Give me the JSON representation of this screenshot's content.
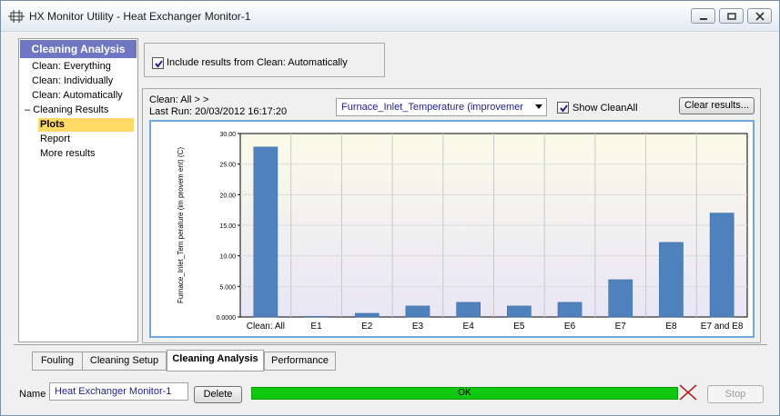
{
  "window": {
    "title": "HX Monitor Utility - Heat Exchanger Monitor-1"
  },
  "sidebar": {
    "header": "Cleaning Analysis",
    "items": [
      {
        "label": "Clean: Everything"
      },
      {
        "label": "Clean: Individually"
      },
      {
        "label": "Clean: Automatically"
      },
      {
        "label": "Cleaning Results"
      },
      {
        "label": "Plots",
        "selected": true
      },
      {
        "label": "Report"
      },
      {
        "label": "More results"
      }
    ]
  },
  "options": {
    "include_label": "Include results from Clean: Automatically",
    "include_checked": true
  },
  "results": {
    "clean_line": "Clean: All > >",
    "last_run": "Last Run: 20/03/2012 16:17:20",
    "variable": "Furnace_Inlet_Temperature (improvemer",
    "show_cleanall_label": "Show CleanAll",
    "show_cleanall_checked": true,
    "clear_label": "Clear results..."
  },
  "chart_data": {
    "type": "bar",
    "ylabel": "Furnace_Inlet_Tem perature (im provem ent) (C)",
    "ylim": [
      0,
      30
    ],
    "yticks": [
      "0.0000",
      "5.000",
      "10.00",
      "15.00",
      "20.00",
      "25.00",
      "30.00"
    ],
    "grid": true,
    "bar_color": "#4f81bd",
    "categories": [
      "Clean: All",
      "E1",
      "E2",
      "E3",
      "E4",
      "E5",
      "E6",
      "E7",
      "E8",
      "E7 and E8"
    ],
    "values": [
      27.8,
      0.1,
      0.6,
      1.8,
      2.4,
      1.8,
      2.4,
      6.1,
      12.2,
      17.0
    ]
  },
  "tabs": [
    {
      "label": "Fouling"
    },
    {
      "label": "Cleaning Setup"
    },
    {
      "label": "Cleaning Analysis",
      "active": true
    },
    {
      "label": "Performance"
    }
  ],
  "footer": {
    "name_label": "Name",
    "name_value": "Heat Exchanger Monitor-1",
    "delete_label": "Delete",
    "status_text": "OK",
    "status_color": "#11c811",
    "stop_label": "Stop"
  }
}
